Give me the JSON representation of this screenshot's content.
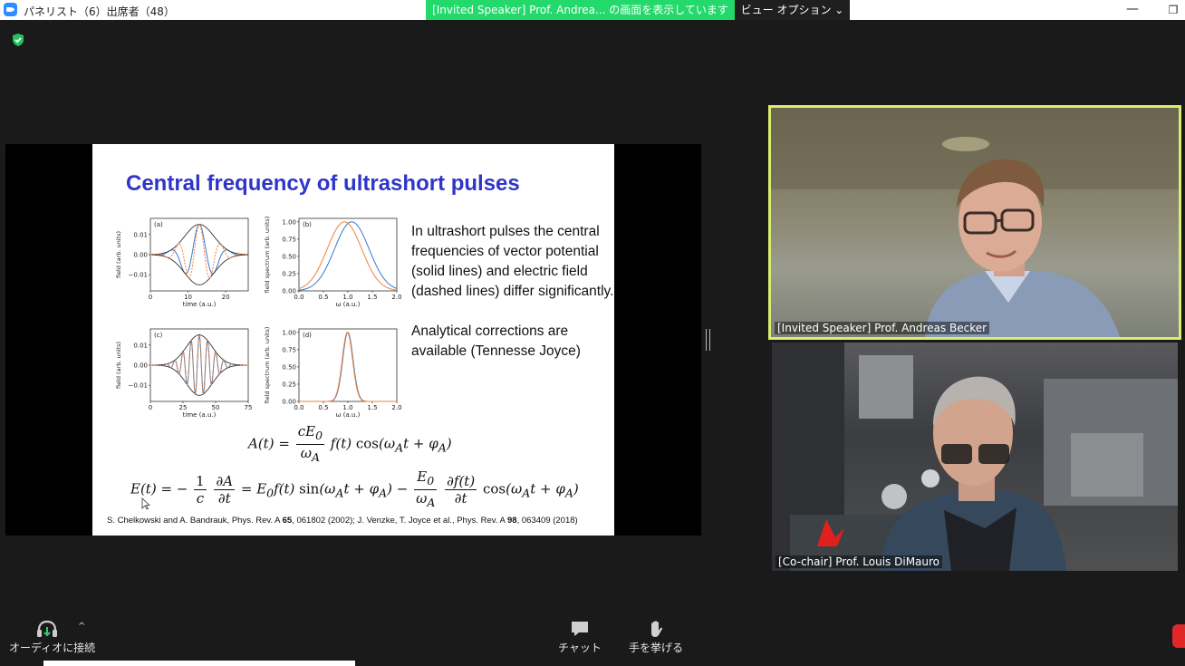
{
  "titlebar": {
    "title": "パネリスト（6）出席者（48）",
    "share_banner": "[Invited Speaker]  Prof. Andrea... の画面を表示しています",
    "view_options": "ビュー オプション ⌄",
    "minimize": "—",
    "restore": "❐"
  },
  "slide": {
    "title": "Central frequency of ultrashort pulses",
    "body": [
      "In ultrashort pulses the central frequencies of vector potential (solid lines) and electric field (dashed lines) differ significantly.",
      "Analytical corrections are available (Tennesse Joyce)"
    ],
    "citation_part1": "S. Chelkowski and A. Bandrauk, Phys. Rev. A ",
    "citation_vol1": "65",
    "citation_part2": ", 061802 (2002); J. Venzke, T. Joyce et al., Phys. Rev. A ",
    "citation_vol2": "98",
    "citation_part3": ", 063409 (2018)",
    "colors": {
      "title": "#2f35c9",
      "vector_potential": "#3a78c9",
      "electric_field": "#f0813a"
    }
  },
  "chart_data": [
    {
      "type": "line",
      "panel": "(a)",
      "xlabel": "time (a.u.)",
      "ylabel": "field (arb. units)",
      "xlim": [
        0,
        26
      ],
      "ylim": [
        -0.018,
        0.018
      ],
      "x_ticks": [
        "0",
        "10",
        "20"
      ],
      "y_ticks": [
        "0.01",
        "0.00",
        "−0.01"
      ],
      "series": [
        {
          "style": "solid",
          "color": "#3a78c9",
          "center": 13,
          "width": 5.5,
          "amplitude": 0.015,
          "omega": 0.8
        },
        {
          "style": "dashed",
          "color": "#f0813a",
          "center": 13,
          "width": 5.5,
          "amplitude": 0.015,
          "omega": 1.1
        }
      ]
    },
    {
      "type": "line",
      "panel": "(b)",
      "xlabel": "ω (a.u.)",
      "ylabel": "field spectrum (arb. units)",
      "xlim": [
        0,
        2.0
      ],
      "ylim": [
        0,
        1.05
      ],
      "x_ticks": [
        "0.0",
        "0.5",
        "1.0",
        "1.5",
        "2.0"
      ],
      "y_ticks": [
        "1.00",
        "0.75",
        "0.50",
        "0.25",
        "0.00"
      ],
      "series": [
        {
          "style": "solid",
          "color": "#3a78c9",
          "center": 1.08,
          "width": 0.5
        },
        {
          "style": "solid",
          "color": "#f0813a",
          "center": 0.93,
          "width": 0.5
        }
      ]
    },
    {
      "type": "line",
      "panel": "(c)",
      "xlabel": "time (a.u.)",
      "ylabel": "field (arb. units)",
      "xlim": [
        0,
        75
      ],
      "ylim": [
        -0.018,
        0.018
      ],
      "x_ticks": [
        "0",
        "25",
        "50",
        "75"
      ],
      "y_ticks": [
        "0.01",
        "0.00",
        "−0.01"
      ],
      "series": [
        {
          "style": "solid",
          "color": "#3a78c9",
          "center": 37.5,
          "width": 14,
          "amplitude": 0.015,
          "omega": 1.0
        },
        {
          "style": "dashed",
          "color": "#f0813a",
          "center": 37.5,
          "width": 14,
          "amplitude": 0.015,
          "omega": 1.0
        }
      ]
    },
    {
      "type": "line",
      "panel": "(d)",
      "xlabel": "ω (a.u.)",
      "ylabel": "field spectrum (arb. units)",
      "xlim": [
        0,
        2.0
      ],
      "ylim": [
        0,
        1.05
      ],
      "x_ticks": [
        "0.0",
        "0.5",
        "1.0",
        "1.5",
        "2.0"
      ],
      "y_ticks": [
        "1.00",
        "0.75",
        "0.50",
        "0.25",
        "0.00"
      ],
      "series": [
        {
          "style": "solid",
          "color": "#3a78c9",
          "center": 1.0,
          "width": 0.15
        },
        {
          "style": "solid",
          "color": "#f0813a",
          "center": 0.99,
          "width": 0.15
        }
      ]
    }
  ],
  "participants": {
    "speaker_name": "[Invited Speaker] Prof. Andreas Becker",
    "cochair_name": "[Co-chair] Prof. Louis DiMauro",
    "active_border": "#d9ed70"
  },
  "toolbar": {
    "audio_label": "オーディオに接続",
    "chat_label": "チャット",
    "raise_hand_label": "手を挙げる"
  }
}
